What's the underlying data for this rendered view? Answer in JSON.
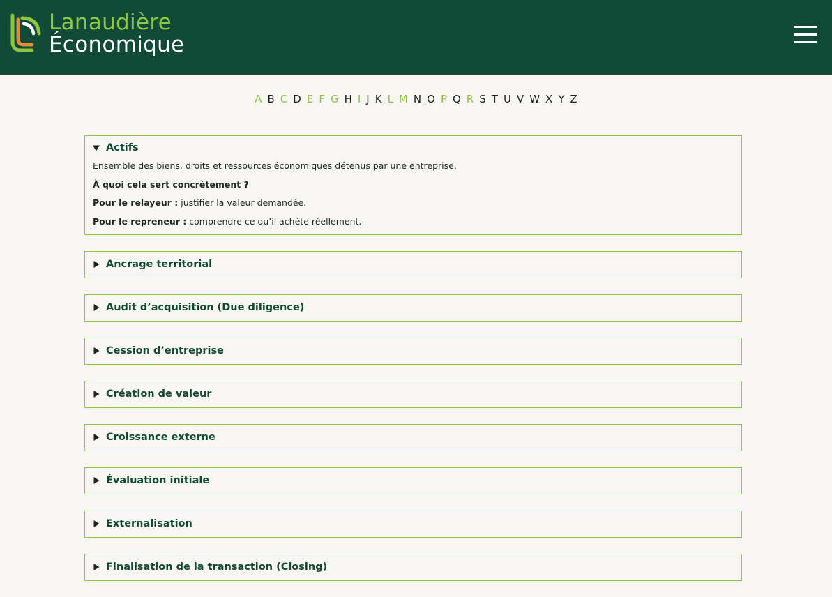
{
  "header": {
    "logo_line1": "Lanaudière",
    "logo_line2": "Économique",
    "brand_green": "#8dc641",
    "brand_orange": "#e8893a",
    "background": "#124a38"
  },
  "alphabet": [
    {
      "letter": "A",
      "active": true
    },
    {
      "letter": "B",
      "active": false
    },
    {
      "letter": "C",
      "active": true
    },
    {
      "letter": "D",
      "active": false
    },
    {
      "letter": "E",
      "active": true
    },
    {
      "letter": "F",
      "active": true
    },
    {
      "letter": "G",
      "active": true
    },
    {
      "letter": "H",
      "active": false
    },
    {
      "letter": "I",
      "active": true
    },
    {
      "letter": "J",
      "active": false
    },
    {
      "letter": "K",
      "active": false
    },
    {
      "letter": "L",
      "active": true
    },
    {
      "letter": "M",
      "active": true
    },
    {
      "letter": "N",
      "active": false
    },
    {
      "letter": "O",
      "active": false
    },
    {
      "letter": "P",
      "active": true
    },
    {
      "letter": "Q",
      "active": false
    },
    {
      "letter": "R",
      "active": true
    },
    {
      "letter": "S",
      "active": false
    },
    {
      "letter": "T",
      "active": false
    },
    {
      "letter": "U",
      "active": false
    },
    {
      "letter": "V",
      "active": false
    },
    {
      "letter": "W",
      "active": false
    },
    {
      "letter": "X",
      "active": false
    },
    {
      "letter": "Y",
      "active": false
    },
    {
      "letter": "Z",
      "active": false
    }
  ],
  "glossary": {
    "open_item": {
      "title": "Actifs",
      "definition": "Ensemble des biens, droits et ressources économiques détenus par une entreprise.",
      "question": "À quoi cela sert concrètement ?",
      "relayeur_label": "Pour le relayeur :",
      "relayeur_text": " justifier la valeur demandée.",
      "repreneur_label": "Pour le repreneur :",
      "repreneur_text": " comprendre ce qu’il achète réellement."
    },
    "items": [
      "Ancrage territorial",
      "Audit d’acquisition (Due diligence)",
      "Cession d’entreprise",
      "Création de valeur",
      "Croissance externe",
      "Évaluation initiale",
      "Externalisation",
      "Finalisation de la transaction (Closing)"
    ]
  }
}
